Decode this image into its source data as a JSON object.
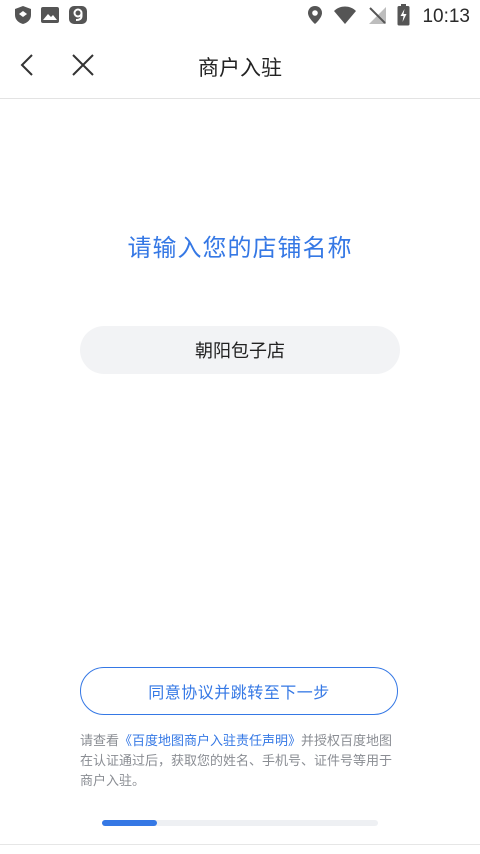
{
  "status_bar": {
    "time": "10:13",
    "left_icons": [
      "shield-icon",
      "image-icon",
      "app-9-icon"
    ],
    "right_icons": [
      "location-icon",
      "wifi-icon",
      "no-signal-icon",
      "battery-charging-icon"
    ]
  },
  "nav": {
    "title": "商户入驻",
    "back_icon": "chevron-left-icon",
    "close_icon": "close-icon"
  },
  "main": {
    "prompt": "请输入您的店铺名称",
    "store_name_value": "朝阳包子店",
    "agree_button_label": "同意协议并跳转至下一步",
    "notice": {
      "prefix": "请查看",
      "link": "《百度地图商户入驻责任声明》",
      "suffix": "并授权百度地图在认证通过后，获取您的姓名、手机号、证件号等用于商户入驻。"
    },
    "progress_fraction": 0.2
  },
  "colors": {
    "accent": "#3578e5",
    "input_bg": "#f2f3f5",
    "muted_text": "#8a8d93"
  }
}
